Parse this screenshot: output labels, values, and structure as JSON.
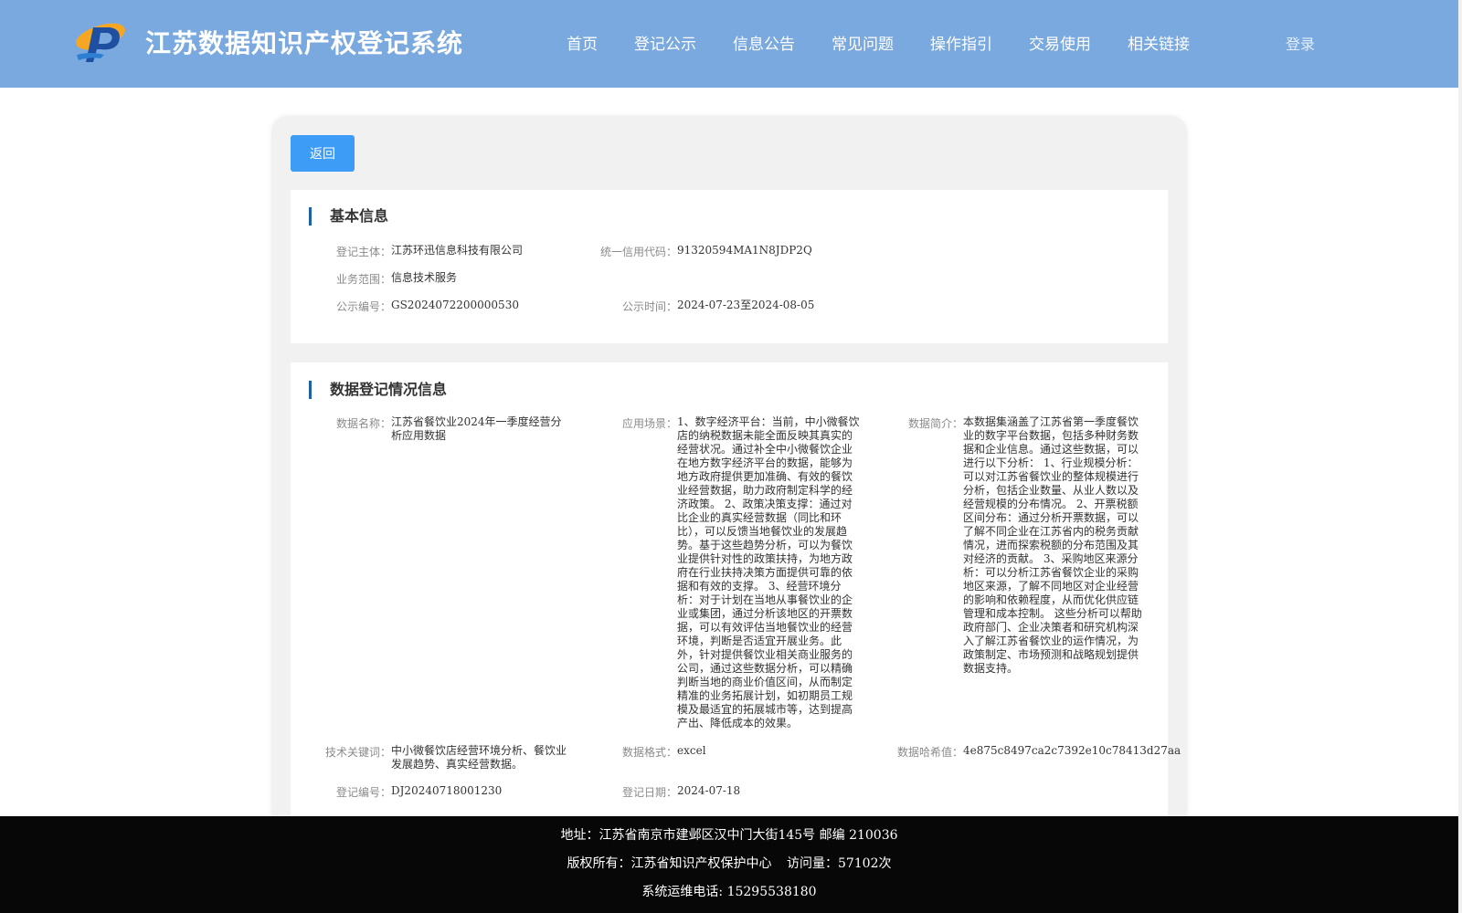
{
  "header": {
    "title": "江苏数据知识产权登记系统",
    "nav": [
      "首页",
      "登记公示",
      "信息公告",
      "常见问题",
      "操作指引",
      "交易使用",
      "相关链接"
    ],
    "login": "登录"
  },
  "back_label": "返回",
  "basic": {
    "title": "基本信息",
    "subject_label": "登记主体：",
    "subject": "江苏环迅信息科技有限公司",
    "credit_label": "统一信用代码：",
    "credit": "91320594MA1N8JDP2Q",
    "scope_label": "业务范围：",
    "scope": "信息技术服务",
    "pub_no_label": "公示编号：",
    "pub_no": "GS2024072200000530",
    "pub_time_label": "公示时间：",
    "pub_time": "2024-07-23至2024-08-05"
  },
  "data": {
    "title": "数据登记情况信息",
    "name_label": "数据名称：",
    "name": "江苏省餐饮业2024年一季度经营分析应用数据",
    "scene_label": "应用场景：",
    "scene": "1、数字经济平台：当前，中小微餐饮店的纳税数据未能全面反映其真实的经营状况。通过补全中小微餐饮企业在地方数字经济平台的数据，能够为地方政府提供更加准确、有效的餐饮业经营数据，助力政府制定科学的经济政策。 2、政策决策支撑：通过对比企业的真实经营数据（同比和环比），可以反馈当地餐饮业的发展趋势。基于这些趋势分析，可以为餐饮业提供针对性的政策扶持，为地方政府在行业扶持决策方面提供可靠的依据和有效的支撑。 3、经营环境分析：对于计划在当地从事餐饮业的企业或集团，通过分析该地区的开票数据，可以有效评估当地餐饮业的经营环境，判断是否适宜开展业务。此外，针对提供餐饮业相关商业服务的公司，通过这些数据分析，可以精确判断当地的商业价值区间，从而制定精准的业务拓展计划，如初期员工规模及最适宜的拓展城市等，达到提高产出、降低成本的效果。",
    "intro_label": "数据简介：",
    "intro": "本数据集涵盖了江苏省第一季度餐饮业的数字平台数据，包括多种财务数据和企业信息。通过这些数据，可以进行以下分析： 1、行业规模分析：可以对江苏省餐饮业的整体规模进行分析，包括企业数量、从业人数以及经营规模的分布情况。 2、开票税额区间分布：通过分析开票数据，可以了解不同企业在江苏省内的税务贡献情况，进而探索税额的分布范围及其对经济的贡献。 3、采购地区来源分析：可以分析江苏省餐饮企业的采购地区来源，了解不同地区对企业经营的影响和依赖程度，从而优化供应链管理和成本控制。 这些分析可以帮助政府部门、企业决策者和研究机构深入了解江苏省餐饮业的运作情况，为政策制定、市场预测和战略规划提供数据支持。",
    "keywords_label": "技术关键词：",
    "keywords": "中小微餐饮店经营环境分析、餐饮业发展趋势、真实经营数据。",
    "format_label": "数据格式：",
    "format": "excel",
    "hash_label": "数据哈希值：",
    "hash": "4e875c8497ca2c7392e10c78413d27aa",
    "reg_no_label": "登记编号：",
    "reg_no": "DJ20240718001230",
    "reg_date_label": "登记日期：",
    "reg_date": "2024-07-18"
  },
  "footer": {
    "address": "地址：江苏省南京市建邺区汉中门大街145号 邮编 210036",
    "copyright": "版权所有：江苏省知识产权保护中心",
    "visits": "访问量：57102次",
    "phone": "系统运维电话: 15295538180"
  },
  "colors": {
    "header_bg": "#7aa9df",
    "button": "#3d9cf6",
    "accent_bar": "#1f5fa8",
    "footer_bg": "#070707"
  }
}
